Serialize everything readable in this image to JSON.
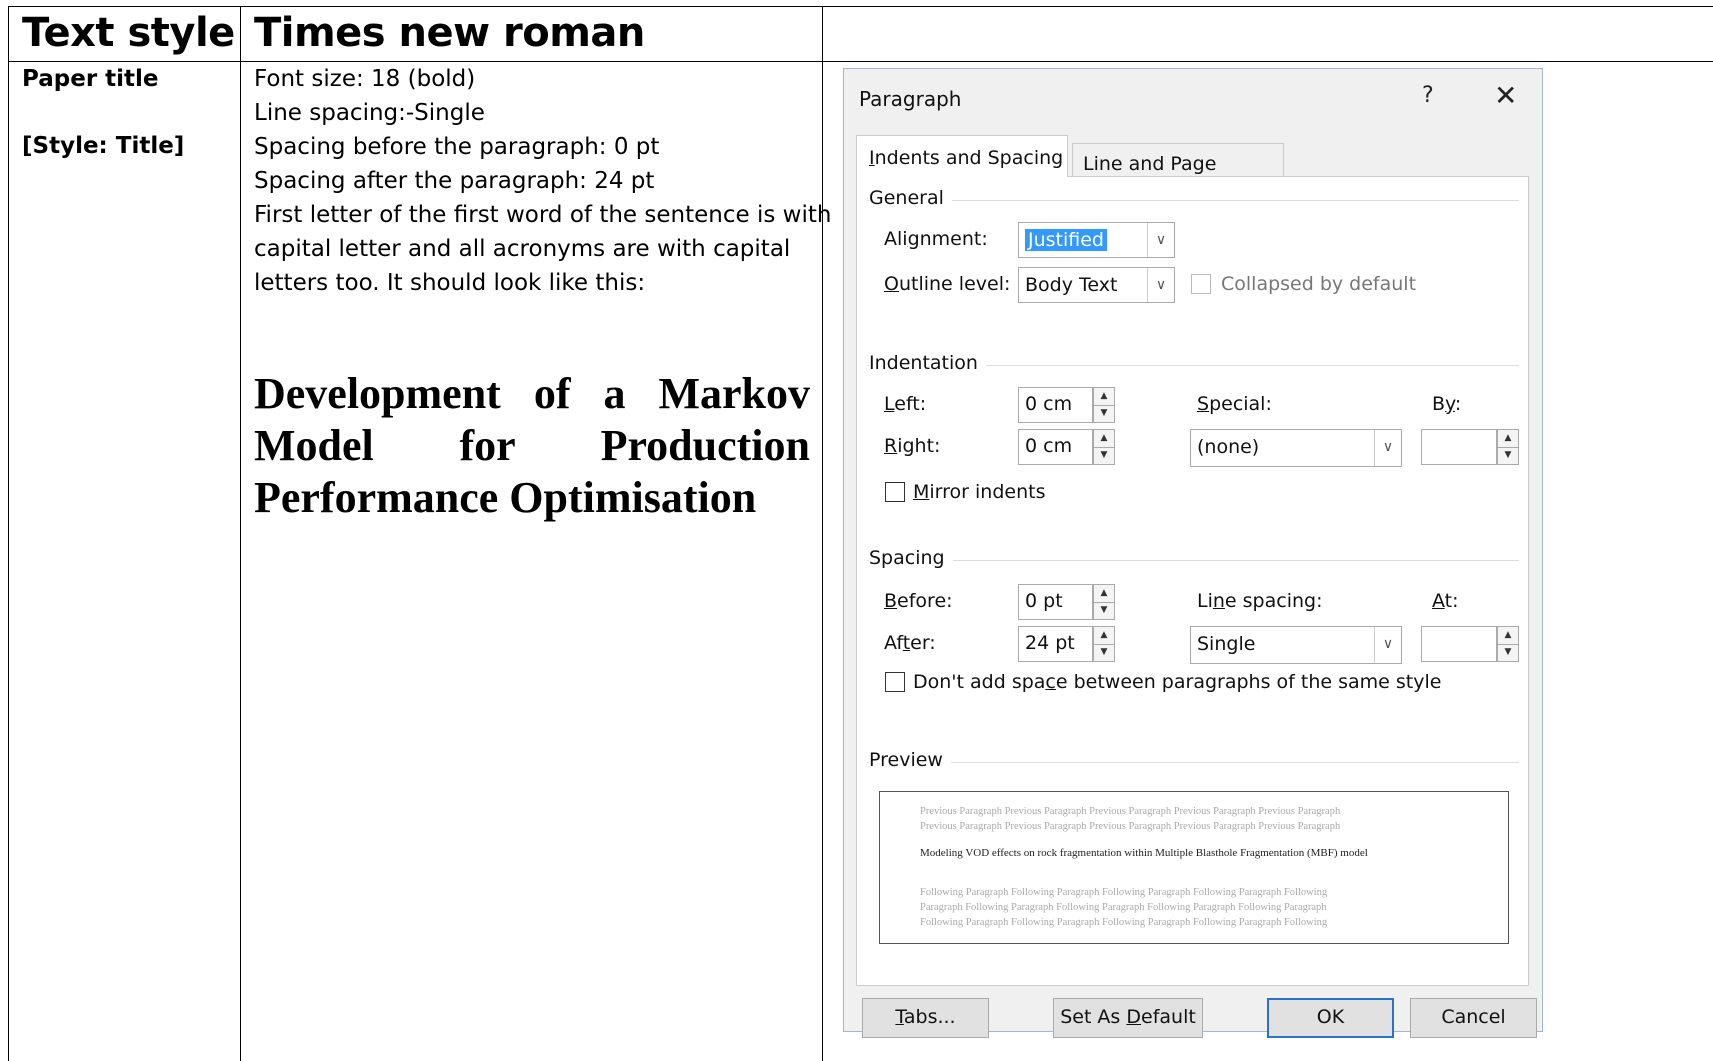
{
  "table": {
    "header_col1": "Text style",
    "header_col2": "Times new roman",
    "row_label": "Paper title",
    "row_style": "[Style: Title]",
    "description_lines": [
      "Font size: 18 (bold)",
      "Line spacing:-Single",
      "Spacing before the paragraph: 0 pt",
      "Spacing after the paragraph: 24 pt",
      "First letter of the first word of the sentence is with",
      "capital letter and all acronyms are with capital",
      "letters too. It should look like this:"
    ],
    "sample_title": "Development of a Markov Model for Production Performance Optimisation"
  },
  "dialog": {
    "title": "Paragraph",
    "help": "?",
    "close": "✕",
    "tabs": [
      "Indents and Spacing",
      "Line and Page Breaks"
    ],
    "general": {
      "section": "General",
      "alignment_label": "Alignment:",
      "alignment_value": "Justified",
      "outline_label": "Outline level:",
      "outline_value": "Body Text",
      "collapsed_label": "Collapsed by default"
    },
    "indentation": {
      "section": "Indentation",
      "left_label": "Left:",
      "left_value": "0 cm",
      "right_label": "Right:",
      "right_value": "0 cm",
      "special_label": "Special:",
      "special_value": "(none)",
      "by_label": "By:",
      "by_value": "",
      "mirror_label": "Mirror indents"
    },
    "spacing": {
      "section": "Spacing",
      "before_label": "Before:",
      "before_value": "0 pt",
      "after_label": "After:",
      "after_value": "24 pt",
      "line_spacing_label": "Line spacing:",
      "line_spacing_value": "Single",
      "at_label": "At:",
      "at_value": "",
      "dont_add_label": "Don't add space between paragraphs of the same style"
    },
    "preview": {
      "section": "Preview",
      "previous_line_1": "Previous Paragraph Previous Paragraph Previous Paragraph Previous Paragraph Previous Paragraph",
      "previous_line_2": "Previous Paragraph Previous Paragraph Previous Paragraph Previous Paragraph Previous Paragraph",
      "sample": "Modeling VOD effects on rock fragmentation within Multiple Blasthole Fragmentation (MBF) model",
      "following_line_1": "Following Paragraph Following Paragraph Following Paragraph Following Paragraph Following",
      "following_line_2": "Paragraph Following Paragraph Following Paragraph Following Paragraph Following Paragraph",
      "following_line_3": "Following Paragraph Following Paragraph Following Paragraph Following Paragraph Following"
    },
    "buttons": {
      "tabs": "Tabs...",
      "set_default": "Set As Default",
      "ok": "OK",
      "cancel": "Cancel"
    },
    "colors": {
      "selection": "#3399ff",
      "ok_border": "#2a73c8"
    }
  }
}
